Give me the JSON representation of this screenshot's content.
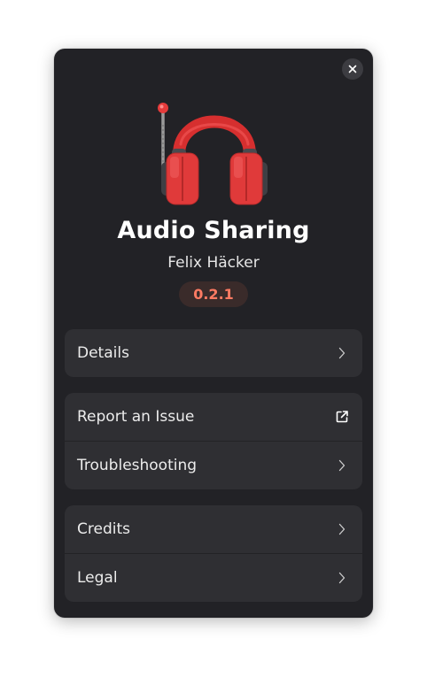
{
  "dialog": {
    "close_icon": "close-icon",
    "app_icon": "headphones-app-icon",
    "app_name": "Audio Sharing",
    "developer": "Felix Häcker",
    "version": "0.2.1"
  },
  "groups": [
    {
      "rows": [
        {
          "label": "Details",
          "icon": "chevron-right-icon"
        }
      ]
    },
    {
      "rows": [
        {
          "label": "Report an Issue",
          "icon": "external-link-icon"
        },
        {
          "label": "Troubleshooting",
          "icon": "chevron-right-icon"
        }
      ]
    },
    {
      "rows": [
        {
          "label": "Credits",
          "icon": "chevron-right-icon"
        },
        {
          "label": "Legal",
          "icon": "chevron-right-icon"
        }
      ]
    }
  ],
  "colors": {
    "dialog_bg": "#222226",
    "row_bg": "#2f2f33",
    "version_text": "#ff7b63",
    "version_bg": "#3a2b2a",
    "icon_red": "#e03a3a"
  }
}
